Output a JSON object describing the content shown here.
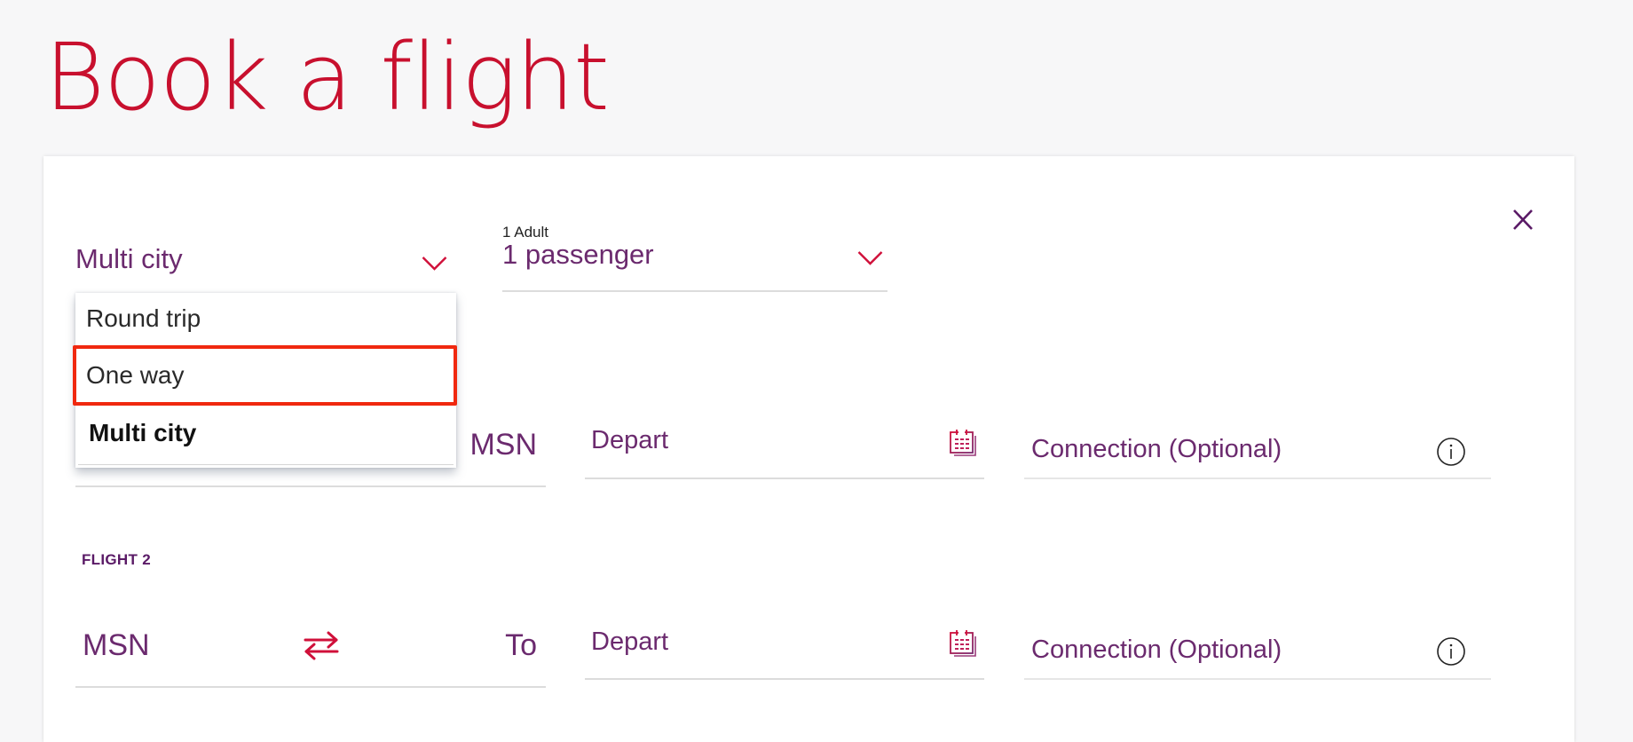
{
  "page": {
    "title": "Book a flight"
  },
  "colors": {
    "brand_red": "#c8102e",
    "brand_purple": "#6b2a6e",
    "highlight": "#f0280f"
  },
  "trip_type": {
    "value": "Multi city",
    "icon": "chevron-down-icon",
    "options": [
      {
        "label": "Round trip",
        "selected": false,
        "highlighted": false
      },
      {
        "label": "One way",
        "selected": false,
        "highlighted": true
      },
      {
        "label": "Multi city",
        "selected": true,
        "highlighted": false
      }
    ]
  },
  "passengers": {
    "caption": "1 Adult",
    "value": "1 passenger",
    "icon": "chevron-down-icon"
  },
  "close": {
    "icon": "close-icon"
  },
  "flights": [
    {
      "label": "",
      "from": "",
      "to": "MSN",
      "depart_placeholder": "Depart",
      "connection_placeholder": "Connection (Optional)",
      "calendar_icon": "calendar-icon",
      "info_icon": "info-icon"
    },
    {
      "label": "FLIGHT 2",
      "from": "MSN",
      "swap_icon": "swap-icon",
      "to_placeholder": "To",
      "depart_placeholder": "Depart",
      "connection_placeholder": "Connection (Optional)",
      "calendar_icon": "calendar-icon",
      "info_icon": "info-icon"
    }
  ]
}
